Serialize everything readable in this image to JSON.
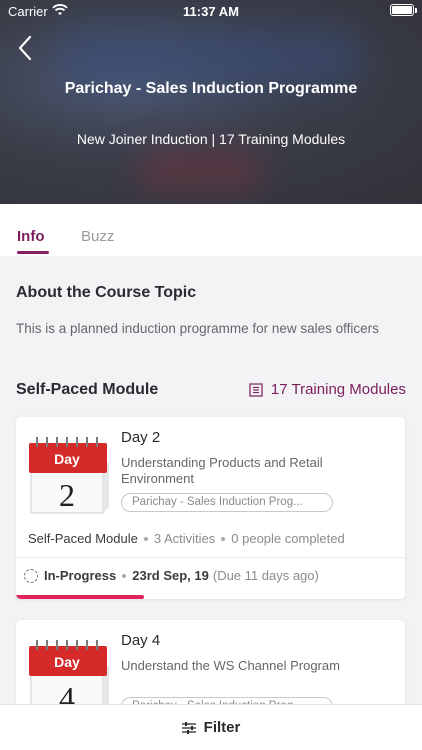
{
  "status_bar": {
    "carrier": "Carrier",
    "time": "11:37 AM"
  },
  "header": {
    "title": "Parichay - Sales Induction Programme",
    "subtitle": "New Joiner Induction | 17 Training Modules"
  },
  "tabs": [
    {
      "label": "Info",
      "active": true
    },
    {
      "label": "Buzz",
      "active": false
    }
  ],
  "about": {
    "heading": "About the Course Topic",
    "description": "This is a planned induction programme for new sales officers"
  },
  "modules": {
    "heading": "Self-Paced Module",
    "count_label": "17 Training Modules",
    "cards": [
      {
        "calendar_label": "Day",
        "calendar_number": "2",
        "title": "Day 2",
        "description": "Understanding Products and Retail Environment",
        "chip": "Parichay - Sales Induction Prog...",
        "type": "Self-Paced Module",
        "activities": "3 Activities",
        "completed": "0 people completed",
        "status": "In-Progress",
        "date": "23rd Sep, 19",
        "due": "(Due 11 days ago)",
        "progress": 0.33
      },
      {
        "calendar_label": "Day",
        "calendar_number": "4",
        "title": "Day 4",
        "description": "Understand the WS Channel Program",
        "chip": "Parichay - Sales Induction Prog..."
      }
    ]
  },
  "filter": {
    "label": "Filter"
  },
  "colors": {
    "accent": "#7a1f5c",
    "progress": "#e2245b",
    "calendar_red": "#d42a2a"
  }
}
